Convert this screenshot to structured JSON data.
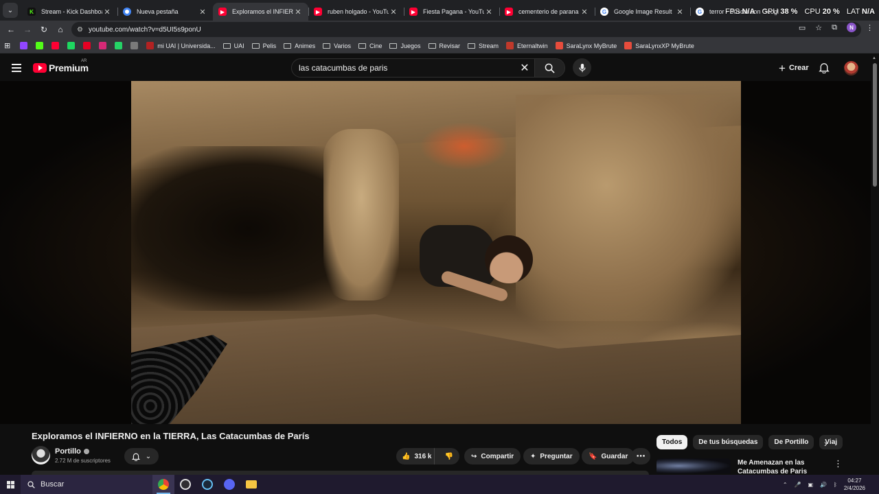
{
  "browser": {
    "tabs": [
      {
        "label": "Stream - Kick Dashboard",
        "favicon": "kick-icon",
        "active": false
      },
      {
        "label": "Nueva pestaña",
        "favicon": "chrome-icon",
        "active": false
      },
      {
        "label": "Exploramos el INFIERNO e",
        "favicon": "youtube-icon",
        "active": true
      },
      {
        "label": "ruben holgado - YouTube",
        "favicon": "youtube-icon",
        "active": false
      },
      {
        "label": "Fiesta Pagana - YouTube",
        "favicon": "youtube-icon",
        "active": false
      },
      {
        "label": "cementerio de parana - Yo",
        "favicon": "youtube-icon",
        "active": false
      },
      {
        "label": "Google Image Result",
        "favicon": "google-icon",
        "active": false
      },
      {
        "label": "terror - Buscar con Googl",
        "favicon": "google-icon",
        "active": false
      }
    ],
    "url": "youtube.com/watch?v=d5UI5s9ponU",
    "overlay": {
      "fps_label": "FPS",
      "fps_value": "N/A",
      "gpu_label": "GPU",
      "gpu_value": "38 %",
      "cpu_label": "CPU",
      "cpu_value": "20 %",
      "lat_label": "LAT",
      "lat_value": "N/A"
    },
    "bookmarks": [
      {
        "label": "",
        "type": "app",
        "color": "#9146ff"
      },
      {
        "label": "",
        "type": "app",
        "color": "#53fc18"
      },
      {
        "label": "",
        "type": "app",
        "color": "#ff0033"
      },
      {
        "label": "",
        "type": "app",
        "color": "#1ed760"
      },
      {
        "label": "",
        "type": "app",
        "color": "#e60023"
      },
      {
        "label": "",
        "type": "app",
        "color": "#d62976"
      },
      {
        "label": "",
        "type": "app",
        "color": "#25d366"
      },
      {
        "label": "",
        "type": "app",
        "color": "#7a7a7a"
      },
      {
        "label": "mi UAI | Universida...",
        "type": "site",
        "color": "#b22222"
      },
      {
        "label": "UAI",
        "type": "folder"
      },
      {
        "label": "Pelis",
        "type": "folder"
      },
      {
        "label": "Animes",
        "type": "folder"
      },
      {
        "label": "Varios",
        "type": "folder"
      },
      {
        "label": "Cine",
        "type": "folder"
      },
      {
        "label": "Juegos",
        "type": "folder"
      },
      {
        "label": "Revisar",
        "type": "folder"
      },
      {
        "label": "Stream",
        "type": "folder"
      },
      {
        "label": "Eternaltwin",
        "type": "site",
        "color": "#c0392b"
      },
      {
        "label": "SaraLynx MyBrute",
        "type": "site",
        "color": "#e74c3c"
      },
      {
        "label": "SaraLynxXP MyBrute",
        "type": "site",
        "color": "#e74c3c"
      }
    ],
    "profile_initial": "N"
  },
  "youtube": {
    "logo_text": "Premium",
    "country_code": "AR",
    "search_value": "las catacumbas de paris",
    "create_label": "Crear",
    "video": {
      "title": "Exploramos el INFIERNO en la TIERRA, Las Catacumbas de París",
      "channel": "Portillo",
      "subscribers": "2.72 M de suscriptores",
      "likes": "316 k",
      "share_label": "Compartir",
      "ask_label": "Preguntar",
      "save_label": "Guardar"
    },
    "chips": [
      "Todos",
      "De tus búsquedas",
      "De Portillo",
      "Viaj"
    ],
    "recommendation": {
      "title": "Me Amenazan en las Catacumbas de Paris"
    }
  },
  "taskbar": {
    "search_label": "Buscar",
    "apps": [
      "chrome-icon",
      "obs-icon",
      "steam-icon",
      "discord-icon",
      "file-explorer-icon"
    ],
    "time": "04:27",
    "date": "2/4/2026"
  }
}
